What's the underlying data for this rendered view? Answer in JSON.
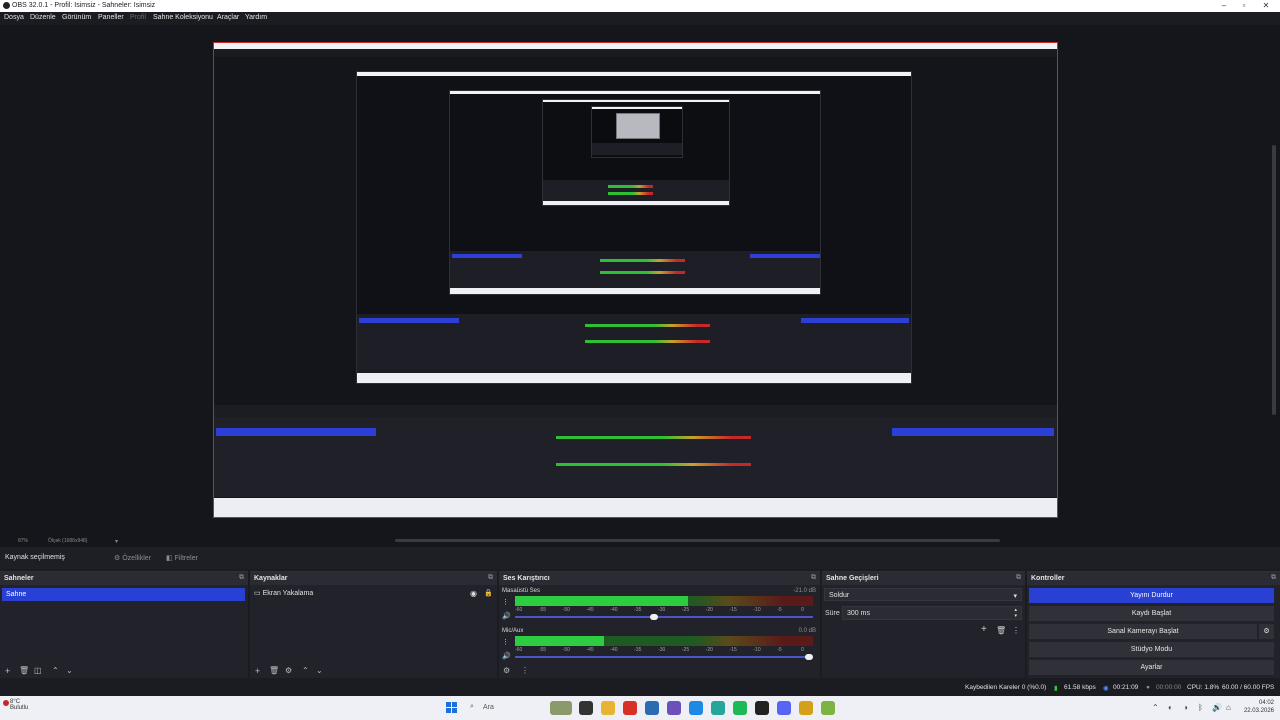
{
  "window": {
    "title": "OBS 32.0.1 - Profil: Isimsiz - Sahneler: Isimsiz"
  },
  "menu": {
    "items": [
      "Dosya",
      "Düzenle",
      "Görünüm",
      "Paneller",
      "Profil",
      "Sahne Koleksiyonu",
      "Araçlar",
      "Yardım"
    ]
  },
  "zoom": {
    "level": "87%",
    "scale": "Ölçek (1686x948)"
  },
  "context": {
    "label": "Kaynak seçilmemiş",
    "properties": "Özellikler",
    "filters": "Filtreler"
  },
  "scenes": {
    "title": "Sahneler",
    "items": [
      "Sahne"
    ]
  },
  "sources": {
    "title": "Kaynaklar",
    "items": [
      "Ekran Yakalama"
    ]
  },
  "mixer": {
    "title": "Ses Karıştırıcı",
    "tracks": [
      {
        "name": "Masaüstü Ses",
        "db": "-21.0 dB",
        "level": 0.58,
        "volume": 0.48
      },
      {
        "name": "Mic/Aux",
        "db": "0.0 dB",
        "level": 0.3,
        "volume": 1.0
      }
    ],
    "ticks": [
      "-60",
      "-55",
      "-50",
      "-45",
      "-40",
      "-35",
      "-30",
      "-25",
      "-20",
      "-15",
      "-10",
      "-5",
      "0"
    ]
  },
  "transitions": {
    "title": "Sahne Geçişleri",
    "type": "Soldur",
    "duration_label": "Süre",
    "duration": "300 ms"
  },
  "controls": {
    "title": "Kontroller",
    "buttons": [
      "Yayını Durdur",
      "Kaydı Başlat",
      "Sanal Kamerayı Başlat",
      "Stüdyo Modu",
      "Ayarlar"
    ]
  },
  "status": {
    "dropped": "Kaybedilen Kareler 0 (%0.0)",
    "bitrate": "61.58 kbps",
    "stream_time": "00:21:09",
    "rec_time": "00:00:00",
    "cpu": "CPU: 1.8%",
    "fps": "60.00 / 60.00 FPS"
  },
  "taskbar": {
    "temp": "8°C",
    "weather": "Bulutlu",
    "search_placeholder": "Ara",
    "time": "04:02",
    "date": "22.03.2026"
  },
  "colors": {
    "accent": "#2840d4",
    "meter_green": "#2ecc40",
    "meter_yellow": "#c7a12a",
    "meter_red": "#c62828"
  }
}
